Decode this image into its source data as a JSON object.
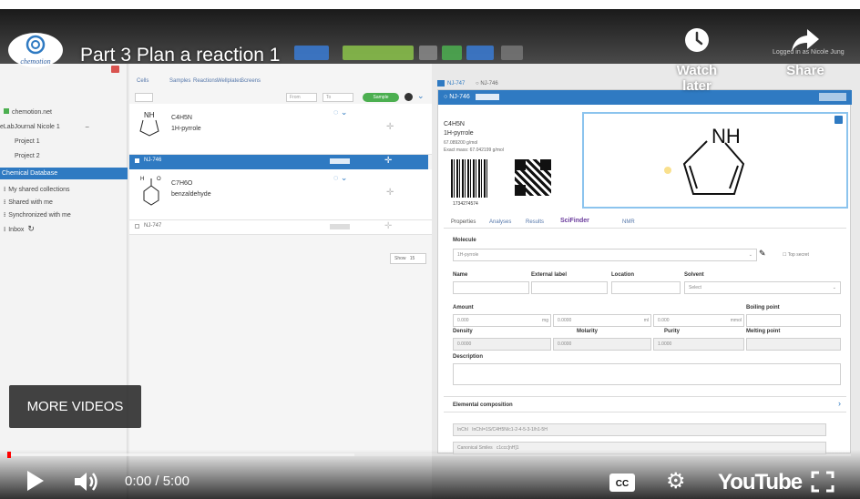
{
  "video": {
    "title": "Part 3 Plan a reaction 1",
    "logo_text": "chemotion",
    "watch_later_label": "Watch later",
    "share_label": "Share",
    "more_videos_label": "MORE VIDEOS",
    "time_current": "0:00",
    "time_separator": " / ",
    "time_total": "5:00",
    "progress_played_fraction": 0.0,
    "progress_loaded_fraction": 0.41,
    "youtube_label": "YouTube",
    "accent": "#ff0000"
  },
  "app": {
    "header_right": "Logged in as Nicole Jung",
    "sidebar": {
      "items": [
        "chemotion.net",
        "eLabJournal Nicole 1",
        "Project 1",
        "Project 2",
        "Chemical Database",
        "My shared collections",
        "Shared with me",
        "Synchronized with me",
        "Inbox"
      ]
    },
    "list": {
      "tabs": [
        "Cells",
        "Samples",
        "Reactions",
        "Wellplates",
        "Screens"
      ],
      "from_placeholder": "From",
      "to_placeholder": "To",
      "toggle_label": "Sample",
      "items": [
        {
          "formula": "C4H5N",
          "name": "1H-pyrrole",
          "code": "NJ-746"
        },
        {
          "formula": "C7H6O",
          "name": "benzaldehyde",
          "code": "NJ-747"
        }
      ],
      "selected_code": "NJ-746",
      "show_label": "Show",
      "show_value": "15"
    },
    "detail": {
      "tabs_top": [
        "NJ-747",
        "NJ-746"
      ],
      "header": "NJ-746",
      "formula": "C4H5N",
      "name": "1H-pyrrole",
      "mol_weight": "67.089200 g/mol",
      "exact_mass": "Exact mass: 67.042199 g/mol",
      "barcode_number": "1734274574",
      "structure_label": "NH",
      "tabs": [
        "Properties",
        "Analyses",
        "Results",
        "SciFinder",
        "NMR"
      ],
      "molecule_label": "Molecule",
      "molecule_value": "1H-pyrrole",
      "top_secret_label": "Top secret",
      "name_label": "Name",
      "external_label": "External label",
      "location_label": "Location",
      "solvent_label": "Solvent",
      "solvent_placeholder": "Select",
      "amount_label": "Amount",
      "boiling_label": "Boiling point",
      "density_label": "Density",
      "molarity_label": "Molarity",
      "purity_label": "Purity",
      "melting_label": "Melting point",
      "amount_values": [
        "0.000",
        "0.0000",
        "0.000"
      ],
      "amount_units": [
        "mg",
        "ml",
        "mmol"
      ],
      "density_value": "0.0000",
      "molarity_value": "0.0000",
      "purity_value": "1.0000",
      "description_label": "Description",
      "elemental_label": "Elemental composition",
      "inchi_label": "InChI",
      "inchi_value": "InChI=1S/C4H5N/c1-2-4-5-3-1/h1-5H",
      "smiles_label": "Canonical Smiles",
      "smiles_value": "c1ccc[nH]1"
    }
  }
}
